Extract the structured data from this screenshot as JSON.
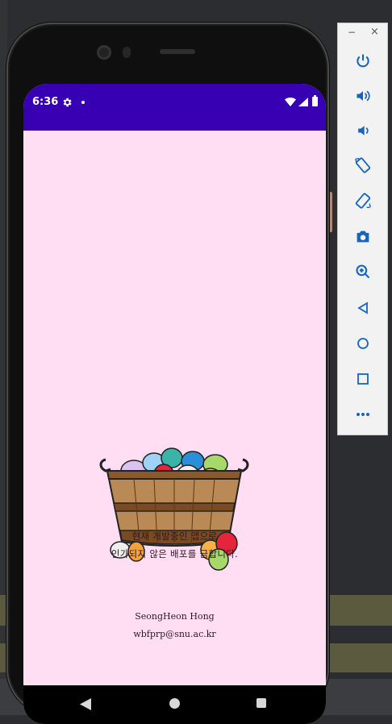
{
  "status_bar": {
    "time": "6:36"
  },
  "app": {
    "notice_line1": "현재 개발중인 앱으로",
    "notice_line2": "인가되지 않은 배포를 금합니다.",
    "author_name": "SeongHeon Hong",
    "author_email": "wbfprp@snu.ac.kr",
    "background_color": "#ffddf3",
    "statusbar_color": "#3700b3"
  },
  "emulator_toolbar": {
    "minimize_label": "−",
    "close_label": "×",
    "buttons": [
      "power-icon",
      "volume-up-icon",
      "volume-down-icon",
      "rotate-left-icon",
      "rotate-right-icon",
      "camera-icon",
      "zoom-icon",
      "back-icon",
      "home-icon",
      "overview-icon",
      "more-icon"
    ]
  }
}
